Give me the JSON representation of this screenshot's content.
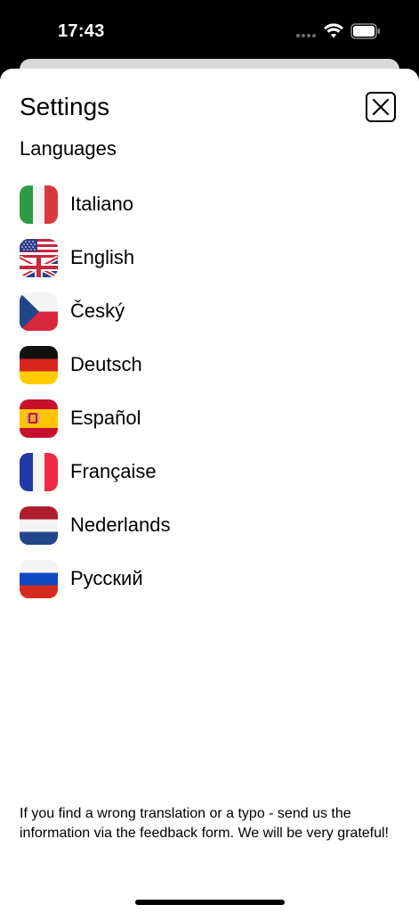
{
  "status": {
    "time": "17:43"
  },
  "settings": {
    "title": "Settings",
    "close_icon": "close-icon",
    "languages_title": "Languages",
    "languages": [
      {
        "label": "Italiano",
        "flag": "flag-italy-icon"
      },
      {
        "label": "English",
        "flag": "flag-usa-uk-icon"
      },
      {
        "label": "Český",
        "flag": "flag-czech-icon"
      },
      {
        "label": "Deutsch",
        "flag": "flag-germany-icon"
      },
      {
        "label": "Español",
        "flag": "flag-spain-icon"
      },
      {
        "label": "Française",
        "flag": "flag-france-icon"
      },
      {
        "label": "Nederlands",
        "flag": "flag-netherlands-icon"
      },
      {
        "label": "Русский",
        "flag": "flag-russia-icon"
      }
    ],
    "footer_note": "If you find a wrong translation or a typo - send us the information via the feedback form. We will be very grateful!"
  },
  "colors": {
    "background": "#000000",
    "sheet": "#ffffff",
    "back_sheet": "#d9d9d9",
    "text": "#000000"
  }
}
